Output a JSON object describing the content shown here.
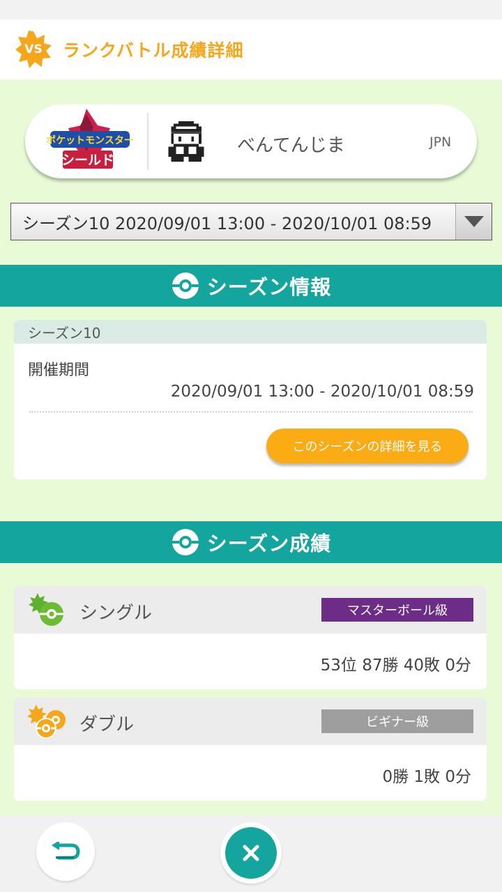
{
  "header": {
    "badge": "VS",
    "title": "ランクバトル成績詳細"
  },
  "profile": {
    "game_logo_icon": "pokemon-shield-logo",
    "game_logo_line1": "ポケットモンスター",
    "game_logo_line2": "シールド",
    "avatar_icon": "trainer-pixel-avatar-icon",
    "name": "べんてんじま",
    "region": "JPN"
  },
  "season_select": {
    "value": "シーズン10 2020/09/01 13:00 - 2020/10/01 08:59"
  },
  "season_info": {
    "section_title": "シーズン情報",
    "card_title": "シーズン10",
    "period_label": "開催期間",
    "period_value": "2020/09/01 13:00 - 2020/10/01 08:59",
    "details_button": "このシーズンの詳細を見る"
  },
  "season_results": {
    "section_title": "シーズン成績",
    "single": {
      "title": "シングル",
      "class": "マスターボール級",
      "class_color": "#6d2d87",
      "result": "53位 87勝 40敗 0分"
    },
    "double": {
      "title": "ダブル",
      "class": "ビギナー級",
      "class_color": "#9e9e9e",
      "result": "0勝 1敗 0分"
    }
  },
  "colors": {
    "accent_orange": "#f6a61a",
    "teal": "#14a59f",
    "light_green_bg": "#e9fbd6"
  },
  "footer": {
    "back_icon": "return-arrow-icon",
    "close_icon": "close-icon"
  }
}
